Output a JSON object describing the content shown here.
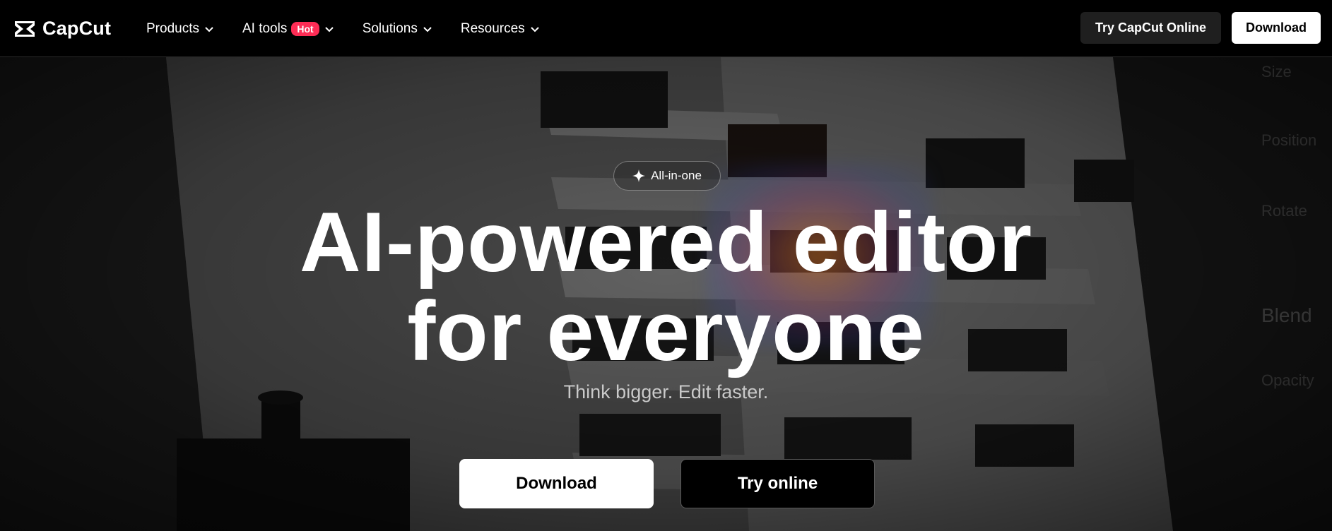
{
  "nav": {
    "logo_text": "CapCut",
    "menu": [
      {
        "label": "Products"
      },
      {
        "label": "AI tools",
        "badge": "Hot"
      },
      {
        "label": "Solutions"
      },
      {
        "label": "Resources"
      }
    ],
    "try_online_label": "Try CapCut Online",
    "download_label": "Download"
  },
  "hero": {
    "pill_label": "All-in-one",
    "headline_line1": "AI-powered editor",
    "headline_line2": "for everyone",
    "subtitle": "Think bigger. Edit faster.",
    "download_label": "Download",
    "try_online_label": "Try online",
    "ghost_panel": [
      "Size",
      "Position",
      "Rotate",
      "Blend",
      "Opacity"
    ]
  },
  "colors": {
    "badge_hot": "#fe2c55",
    "nav_bg": "#000000",
    "button_dark": "#1f1f1f"
  },
  "icons": {
    "logo": "capcut-logo-icon",
    "chevron": "chevron-down-icon",
    "sparkle": "sparkle-icon"
  }
}
